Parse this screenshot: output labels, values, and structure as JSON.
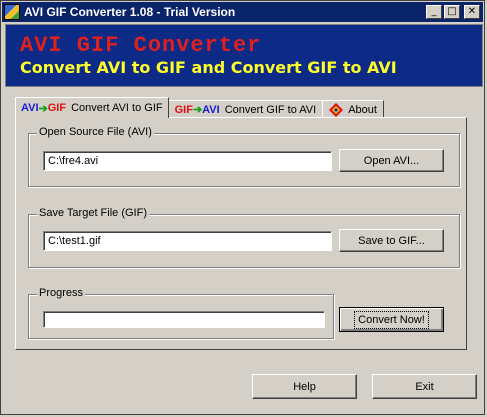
{
  "window": {
    "title": "AVI GIF Converter 1.08 - Trial Version"
  },
  "titlebar": {
    "minimize": "_",
    "maximize": "□",
    "close": "✕"
  },
  "banner": {
    "title": "AVI GIF Converter",
    "subtitle": "Convert AVI to GIF and Convert GIF to AVI"
  },
  "tabs": [
    {
      "icon_left": "AVI",
      "icon_right": "GIF",
      "label": "Convert AVI to GIF",
      "active": true
    },
    {
      "icon_left": "GIF",
      "icon_right": "AVI",
      "label": "Convert GIF to AVI",
      "active": false
    },
    {
      "icon": "about-icon",
      "label": "About",
      "active": false
    }
  ],
  "arrow": "➔",
  "source": {
    "label": "Open Source File (AVI)",
    "value": "C:\\fre4.avi",
    "button": "Open AVI..."
  },
  "target": {
    "label": "Save Target File (GIF)",
    "value": "C:\\test1.gif",
    "button": "Save to GIF..."
  },
  "progress": {
    "label": "Progress",
    "percent": 0,
    "button": "Convert Now!"
  },
  "footer": {
    "help": "Help",
    "exit": "Exit"
  },
  "colors": {
    "banner_bg": "#0c2a86",
    "banner_title": "#e0201e",
    "banner_sub": "#ffff2a",
    "title_bar": "#0a246a"
  }
}
